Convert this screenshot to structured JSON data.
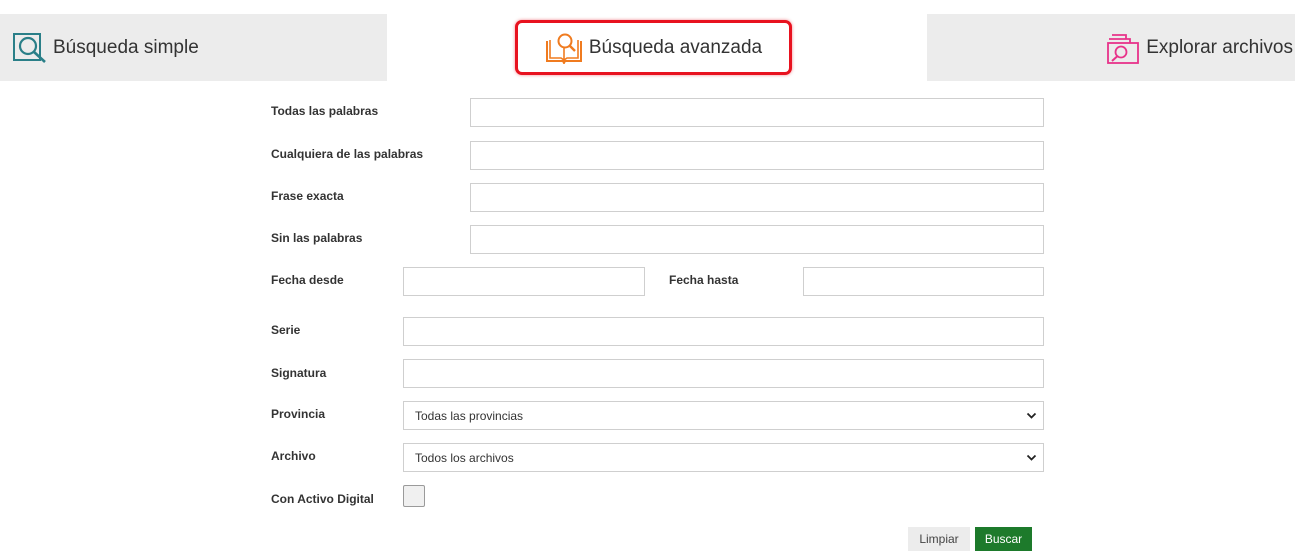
{
  "tabs": {
    "simple": {
      "label": "Búsqueda simple",
      "icon": "magnifier-icon",
      "color": "#2a7f88"
    },
    "advanced": {
      "label": "Búsqueda avanzada",
      "icon": "book-search-icon",
      "color": "#f07b1f",
      "highlight": "#e8121f"
    },
    "explore": {
      "label": "Explorar archivos",
      "icon": "folder-search-icon",
      "color": "#e8338a"
    }
  },
  "form": {
    "all_words": {
      "label": "Todas las palabras",
      "value": ""
    },
    "any_words": {
      "label": "Cualquiera de las palabras",
      "value": ""
    },
    "exact_phrase": {
      "label": "Frase exacta",
      "value": ""
    },
    "without_words": {
      "label": "Sin las palabras",
      "value": ""
    },
    "date_from": {
      "label": "Fecha desde",
      "value": ""
    },
    "date_to": {
      "label": "Fecha hasta",
      "value": ""
    },
    "series": {
      "label": "Serie",
      "value": ""
    },
    "signature": {
      "label": "Signatura",
      "value": ""
    },
    "province": {
      "label": "Provincia",
      "selected": "Todas las provincias"
    },
    "archive": {
      "label": "Archivo",
      "selected": "Todos los archivos"
    },
    "digital_asset": {
      "label": "Con Activo Digital",
      "checked": false
    }
  },
  "buttons": {
    "clear_label": "Limpiar",
    "search_label": "Buscar",
    "search_color": "#1d7a2b"
  }
}
